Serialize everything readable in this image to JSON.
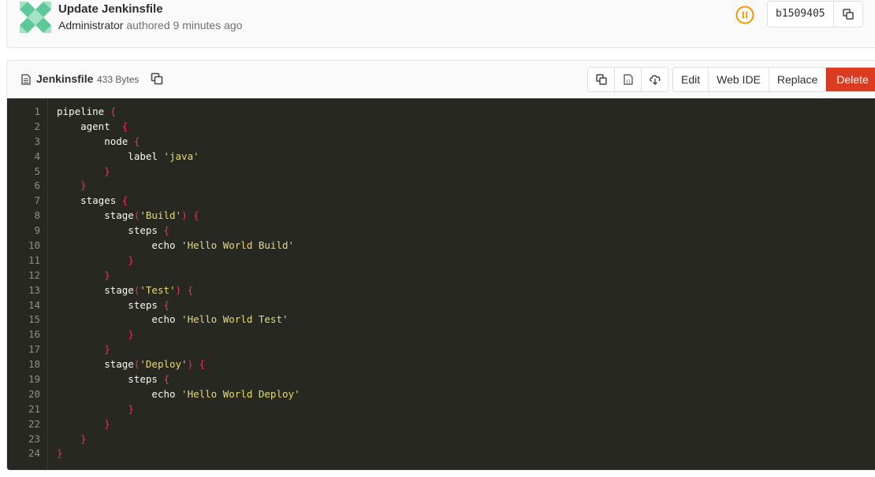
{
  "commit": {
    "title": "Update Jenkinsfile",
    "author": "Administrator",
    "meta_text": "authored 9 minutes ago",
    "sha": "b1509405",
    "pipeline_status_color": "#fc9403"
  },
  "file": {
    "name": "Jenkinsfile",
    "size": "433 Bytes",
    "icon": "file-text-icon"
  },
  "toolbar": {
    "icon_buttons": [
      "copy-source-icon",
      "raw-file-icon",
      "download-icon"
    ],
    "edit_label": "Edit",
    "web_ide_label": "Web IDE",
    "replace_label": "Replace",
    "delete_label": "Delete",
    "delete_color": "#db3b21"
  },
  "code": {
    "theme": {
      "background": "#272822",
      "text": "#f8f8f2",
      "brace": "#f92672",
      "string": "#e6db74",
      "line_number": "#8f908a"
    },
    "lines": [
      "pipeline {",
      "    agent  {",
      "        node {",
      "            label 'java'",
      "        }",
      "    }",
      "    stages {",
      "        stage('Build') {",
      "            steps {",
      "                echo 'Hello World Build'",
      "            }",
      "        }",
      "        stage('Test') {",
      "            steps {",
      "                echo 'Hello World Test'",
      "            }",
      "        }",
      "        stage('Deploy') {",
      "            steps {",
      "                echo 'Hello World Deploy'",
      "            }",
      "        }",
      "    }",
      "}"
    ]
  }
}
